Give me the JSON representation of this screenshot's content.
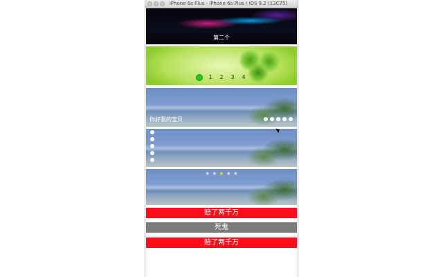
{
  "window": {
    "title": "iPhone 6s Plus - iPhone 6s Plus / iOS 9.2 (13C75)"
  },
  "banners": {
    "first": {
      "caption": "第二个"
    },
    "second": {
      "pages": [
        "1",
        "2",
        "3",
        "4"
      ],
      "active_index": 0
    },
    "third": {
      "caption": "你好我的宝贝",
      "dot_count": 5
    },
    "fourth": {
      "dot_count": 5
    },
    "fifth": {
      "stars": [
        "★",
        "★",
        "★",
        "★",
        "★"
      ],
      "active_index": 2
    }
  },
  "bars": [
    {
      "label": "赔了两千万",
      "color": "#fb0d1b"
    },
    {
      "label": "死鬼",
      "color": "#7c7c7c"
    },
    {
      "label": "赔了两千万",
      "color": "#fb0d1b"
    }
  ],
  "icons": {
    "cursor": "mouse-pointer-icon",
    "window_buttons": [
      "close-button-icon",
      "minimize-button-icon",
      "zoom-button-icon"
    ]
  },
  "colors": {
    "page_indicator_active": "#29c324",
    "star_active": "#f4d63a",
    "star_inactive": "#dcdcdc"
  }
}
